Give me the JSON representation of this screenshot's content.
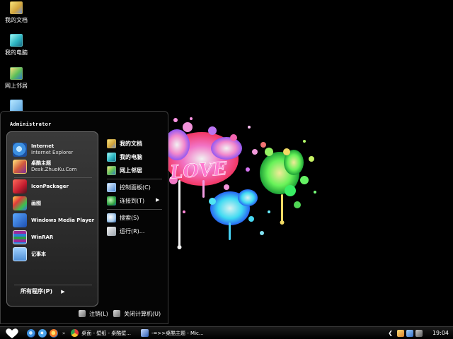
{
  "desktop": {
    "icons": [
      {
        "label": "我的文档",
        "icon": "my-documents-icon"
      },
      {
        "label": "我的电脑",
        "icon": "my-computer-icon"
      },
      {
        "label": "网上邻居",
        "icon": "network-places-icon"
      },
      {
        "label": "",
        "icon": "recycle-bin-icon"
      }
    ],
    "wallpaper_text": "LOVE"
  },
  "start_menu": {
    "user_name": "Administrator",
    "pinned": [
      {
        "title": "Internet",
        "subtitle": "Internet Explorer",
        "icon": "ie-icon"
      },
      {
        "title": "桌酷主题",
        "subtitle": "Desk.ZhuoKu.Com",
        "icon": "theme-icon"
      }
    ],
    "recent": [
      {
        "title": "IconPackager",
        "icon": "iconpackager-icon"
      },
      {
        "title": "画图",
        "icon": "paint-icon"
      },
      {
        "title": "Windows Media Player",
        "icon": "media-player-icon"
      },
      {
        "title": "WinRAR",
        "icon": "winrar-icon"
      },
      {
        "title": "记事本",
        "icon": "notepad-icon"
      }
    ],
    "all_programs": "所有程序(P)",
    "right": [
      {
        "label": "我的文档",
        "icon": "my-documents-icon"
      },
      {
        "label": "我的电脑",
        "icon": "my-computer-icon"
      },
      {
        "label": "网上邻居",
        "icon": "network-places-icon"
      },
      {
        "label": "控制面板(C)",
        "icon": "control-panel-icon"
      },
      {
        "label": "连接到(T)",
        "icon": "connect-to-icon"
      },
      {
        "label": "搜索(S)",
        "icon": "search-icon"
      },
      {
        "label": "运行(R)...",
        "icon": "run-icon"
      }
    ],
    "logoff": "注销(L)",
    "shutdown": "关闭计算机(U)"
  },
  "taskbar": {
    "tasks": [
      {
        "label": "桌面 - 壁纸 - 桌酷壁...",
        "icon": "chrome-icon"
      },
      {
        "label": "-=>>桌酷主题 - Mic...",
        "icon": "word-icon"
      }
    ],
    "clock": "19:04"
  },
  "colors": {
    "background": "#000000",
    "panel": "#2a2a2a",
    "text": "#ffffff"
  }
}
